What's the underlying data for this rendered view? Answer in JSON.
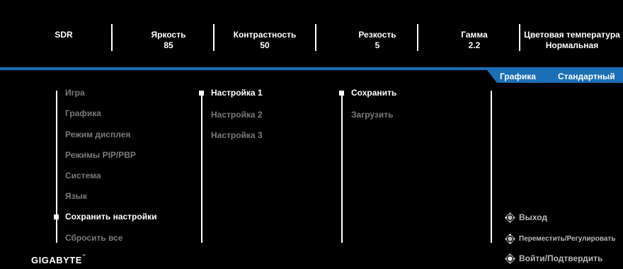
{
  "status_bar": {
    "mode": "SDR",
    "brightness": {
      "label": "Яркость",
      "value": "85"
    },
    "contrast": {
      "label": "Контрастность",
      "value": "50"
    },
    "sharpness": {
      "label": "Резкость",
      "value": "5"
    },
    "gamma": {
      "label": "Гамма",
      "value": "2.2"
    },
    "color_temp": {
      "label": "Цветовая температура",
      "value": "Нормальная"
    }
  },
  "mode_tab": {
    "category": "Графика",
    "preset": "Стандартный"
  },
  "main_menu": [
    {
      "label": "Игра"
    },
    {
      "label": "Графика"
    },
    {
      "label": "Режим дисплея"
    },
    {
      "label": "Режимы PIP/PBP"
    },
    {
      "label": "Система"
    },
    {
      "label": "Язык"
    },
    {
      "label": "Сохранить настройки",
      "selected": true
    },
    {
      "label": "Сбросить все"
    }
  ],
  "settings_menu": [
    {
      "label": "Настройка 1",
      "selected": true
    },
    {
      "label": "Настройка 2"
    },
    {
      "label": "Настройка 3"
    }
  ],
  "action_menu": [
    {
      "label": "Сохранить",
      "selected": true
    },
    {
      "label": "Загрузить"
    }
  ],
  "hints": {
    "exit": "Выход",
    "move_adjust": "Переместить/Регулировать",
    "enter_confirm": "Войти/Подтвердить"
  },
  "brand": "GIGABYTE",
  "trademark": "™",
  "icons": {
    "joystick": "joystick-icon",
    "selected_marker": "square-bullet-icon"
  },
  "colors": {
    "accent": "#1c6fb6",
    "background": "#000000",
    "active_text": "#ffffff",
    "inactive_text": "#7a7a7a"
  }
}
